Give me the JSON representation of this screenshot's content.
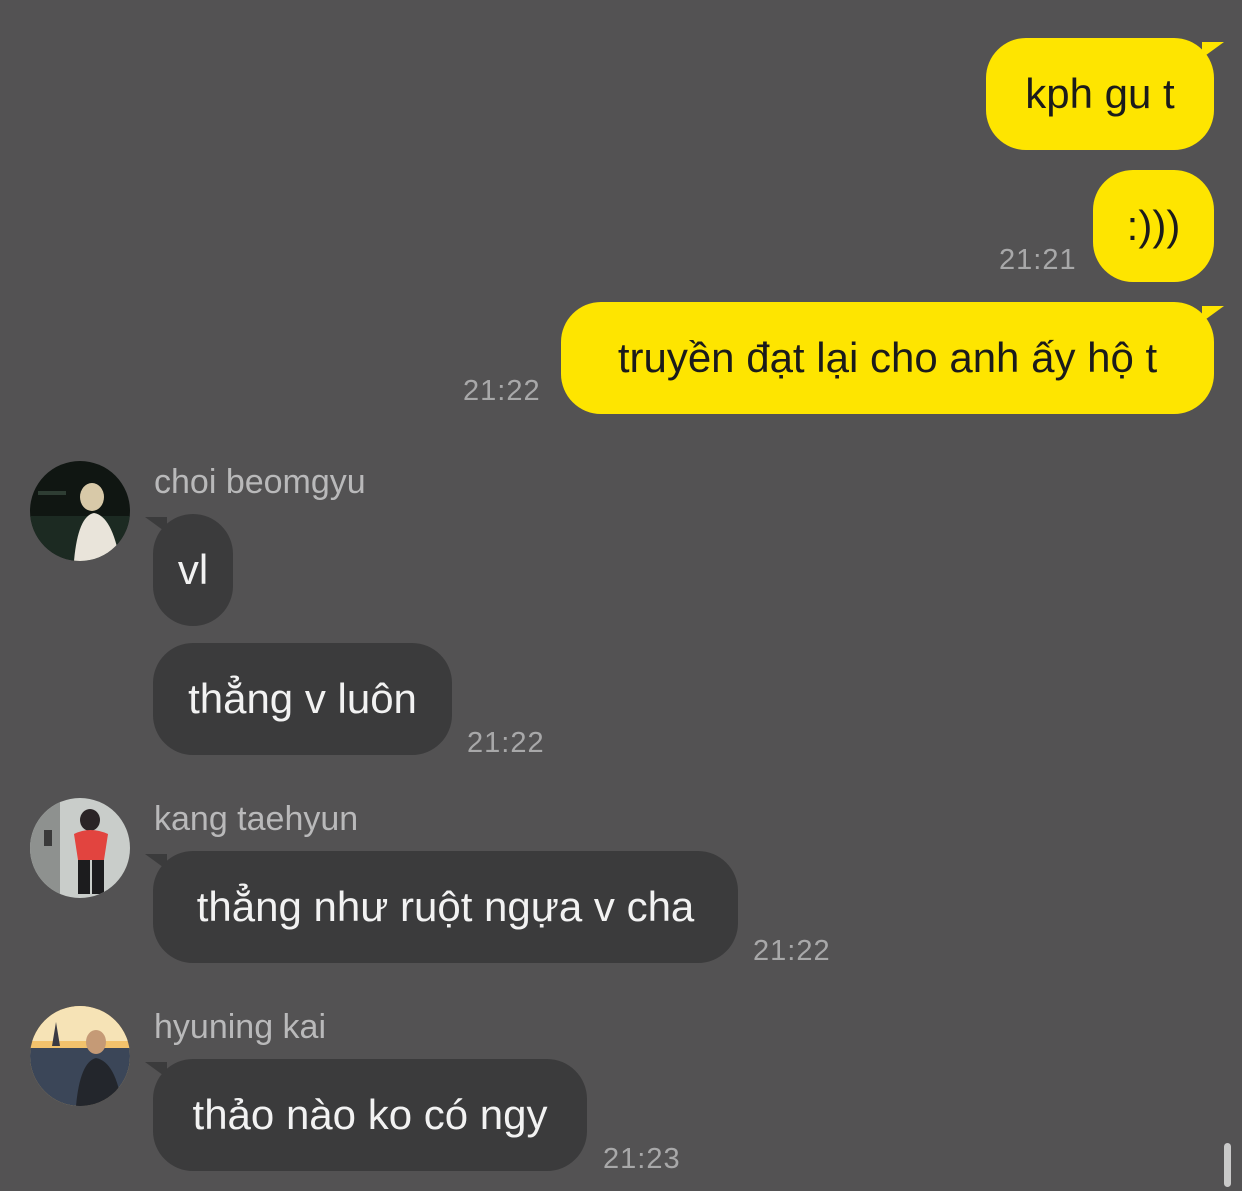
{
  "messages": {
    "sent": [
      {
        "text": "kph gu t",
        "time": ""
      },
      {
        "text": ":)))",
        "time": "21:21"
      },
      {
        "text": "truyền đạt lại cho anh ấy hộ t",
        "time": "21:22"
      }
    ],
    "beomgyu": {
      "name": "choi beomgyu",
      "msg1": "vl",
      "msg2": "thẳng v luôn",
      "time": "21:22"
    },
    "taehyun": {
      "name": "kang taehyun",
      "msg1": "thẳng như ruột ngựa v cha",
      "time": "21:22"
    },
    "kai": {
      "name": "hyuning kai",
      "msg1": "thảo nào ko có ngy",
      "time": "21:23"
    }
  },
  "colors": {
    "background": "#535253",
    "sent_bubble": "#fee500",
    "received_bubble": "#3b3b3c",
    "timestamp": "#a8a8a9"
  }
}
